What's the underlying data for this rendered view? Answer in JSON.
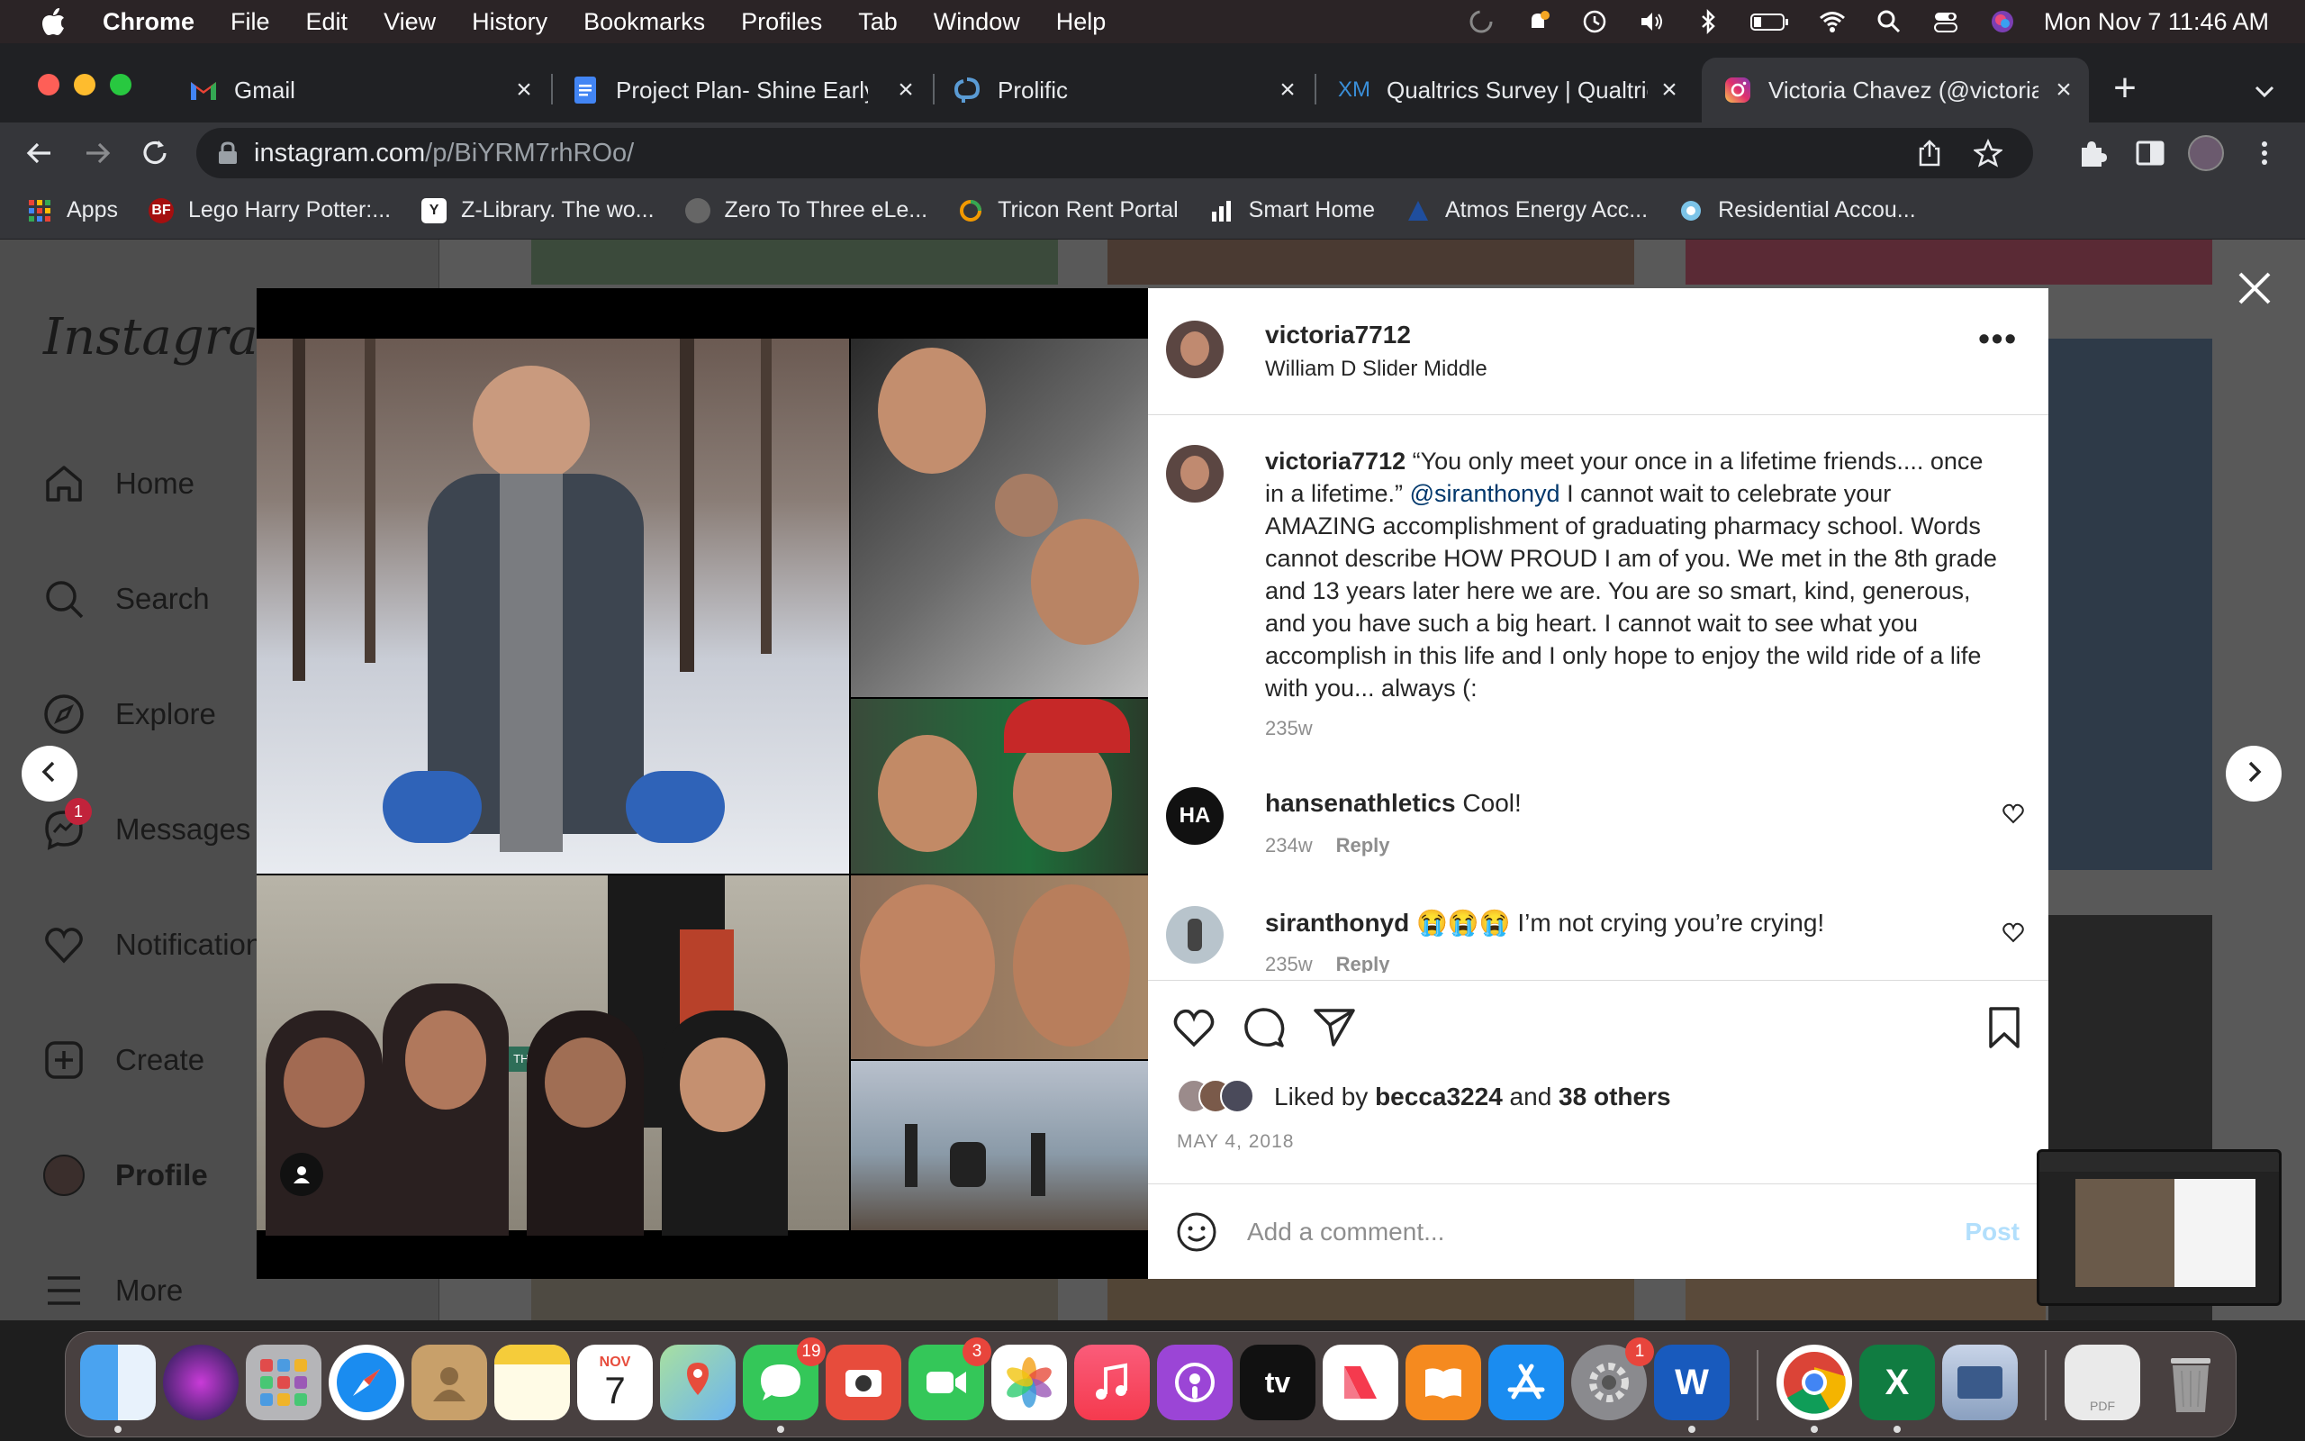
{
  "menubar": {
    "app_name": "Chrome",
    "items": [
      "File",
      "Edit",
      "View",
      "History",
      "Bookmarks",
      "Profiles",
      "Tab",
      "Window",
      "Help"
    ],
    "clock": "Mon Nov 7  11:46 AM"
  },
  "tabs": [
    {
      "title": "Gmail",
      "icon": "gmail-icon"
    },
    {
      "title": "Project Plan- Shine Early L",
      "icon": "docs-icon"
    },
    {
      "title": "Prolific",
      "icon": "prolific-icon"
    },
    {
      "title": "Qualtrics Survey | Qualtric",
      "icon": "qualtrics-icon"
    },
    {
      "title": "Victoria Chavez (@victoria",
      "icon": "instagram-icon",
      "active": true
    }
  ],
  "omnibox": {
    "domain": "instagram.com",
    "path": "/p/BiYRM7rhROo/"
  },
  "bookmarks": [
    {
      "label": "Apps",
      "color": "#ea4335"
    },
    {
      "label": "Lego Harry Potter:...",
      "color": "#a50f0f"
    },
    {
      "label": "Z-Library. The wo...",
      "color": "#ffffff"
    },
    {
      "label": "Zero To Three eLe...",
      "color": "#777777"
    },
    {
      "label": "Tricon Rent Portal",
      "color": "#f29900"
    },
    {
      "label": "Smart Home",
      "color": "#ffffff"
    },
    {
      "label": "Atmos Energy Acc...",
      "color": "#1f4e9e"
    },
    {
      "label": "Residential Accou...",
      "color": "#7cc4e8"
    }
  ],
  "sidebar": {
    "logo": "Instagram",
    "items": [
      {
        "label": "Home",
        "icon": "home-icon"
      },
      {
        "label": "Search",
        "icon": "search-icon"
      },
      {
        "label": "Explore",
        "icon": "compass-icon"
      },
      {
        "label": "Messages",
        "icon": "messenger-icon",
        "badge": "1"
      },
      {
        "label": "Notifications",
        "icon": "heart-icon"
      },
      {
        "label": "Create",
        "icon": "plus-square-icon"
      },
      {
        "label": "Profile",
        "icon": "avatar"
      },
      {
        "label": "More",
        "icon": "menu-icon"
      }
    ]
  },
  "post": {
    "username": "victoria7712",
    "location": "William D Slider Middle",
    "caption_user": "victoria7712",
    "caption_part1": " “You only meet your once in a lifetime friends.... once in a lifetime.” ",
    "caption_mention": "@siranthonyd",
    "caption_part2": " I cannot wait to celebrate your AMAZING accomplishment of graduating pharmacy school. Words cannot describe HOW PROUD I am of you. We met in the 8th grade and 13 years later here we are. You are so smart, kind, generous, and you have such a big heart. I cannot wait to see what you accomplish in this life and I only hope to enjoy the wild ride of a life with you... always (:",
    "caption_age": "235w",
    "comments": [
      {
        "user": "hansenathletics",
        "text": "Cool!",
        "age": "234w",
        "reply": "Reply"
      },
      {
        "user": "siranthonyd",
        "text": "😭😭😭 I’m not crying you’re crying!",
        "age": "235w",
        "reply": "Reply"
      }
    ],
    "liked_by_prefix": "Liked by ",
    "liked_by_user": "becca3224",
    "liked_by_and": " and ",
    "liked_by_others": "38 others",
    "date": "MAY 4, 2018",
    "comment_placeholder": "Add a comment...",
    "post_button": "Post",
    "photo_sign_text": "THEATRE"
  },
  "dock": {
    "calendar_month": "NOV",
    "calendar_day": "7",
    "messages_badge": "19",
    "facetime_badge": "3",
    "settings_badge": "1",
    "appletv_label": "tv",
    "preview_label": "PDF"
  }
}
